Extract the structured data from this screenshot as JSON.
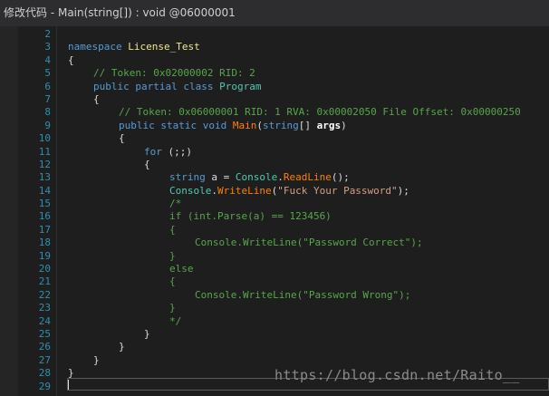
{
  "window": {
    "title": "修改代码 - Main(string[]) : void @06000001"
  },
  "editor": {
    "lines": [
      {
        "n": "2",
        "indent": 0,
        "tokens": []
      },
      {
        "n": "3",
        "indent": 0,
        "tokens": [
          {
            "t": "namespace",
            "k": "keyword"
          },
          {
            "t": " ",
            "k": "plain"
          },
          {
            "t": "License_Test",
            "k": "ns"
          }
        ]
      },
      {
        "n": "4",
        "indent": 0,
        "tokens": [
          {
            "t": "{",
            "k": "plain"
          }
        ]
      },
      {
        "n": "5",
        "indent": 1,
        "tokens": [
          {
            "t": "// Token: 0x02000002 RID: 2",
            "k": "comment"
          }
        ]
      },
      {
        "n": "6",
        "indent": 1,
        "tokens": [
          {
            "t": "public",
            "k": "keyword"
          },
          {
            "t": " ",
            "k": "plain"
          },
          {
            "t": "partial",
            "k": "keyword"
          },
          {
            "t": " ",
            "k": "plain"
          },
          {
            "t": "class",
            "k": "keyword"
          },
          {
            "t": " ",
            "k": "plain"
          },
          {
            "t": "Program",
            "k": "type"
          }
        ]
      },
      {
        "n": "7",
        "indent": 1,
        "tokens": [
          {
            "t": "{",
            "k": "plain"
          }
        ]
      },
      {
        "n": "8",
        "indent": 2,
        "tokens": [
          {
            "t": "// Token: 0x06000001 RID: 1 RVA: 0x00002050 File Offset: 0x00000250",
            "k": "comment"
          }
        ]
      },
      {
        "n": "9",
        "indent": 2,
        "tokens": [
          {
            "t": "public",
            "k": "keyword"
          },
          {
            "t": " ",
            "k": "plain"
          },
          {
            "t": "static",
            "k": "keyword"
          },
          {
            "t": " ",
            "k": "plain"
          },
          {
            "t": "void",
            "k": "keyword"
          },
          {
            "t": " ",
            "k": "plain"
          },
          {
            "t": "Main",
            "k": "method"
          },
          {
            "t": "(",
            "k": "plain"
          },
          {
            "t": "string",
            "k": "keyword"
          },
          {
            "t": "[] ",
            "k": "plain"
          },
          {
            "t": "args",
            "k": "param"
          },
          {
            "t": ")",
            "k": "plain"
          }
        ]
      },
      {
        "n": "10",
        "indent": 2,
        "tokens": [
          {
            "t": "{",
            "k": "plain"
          }
        ]
      },
      {
        "n": "11",
        "indent": 3,
        "tokens": [
          {
            "t": "for",
            "k": "keyword"
          },
          {
            "t": " (;;)",
            "k": "plain"
          }
        ]
      },
      {
        "n": "12",
        "indent": 3,
        "tokens": [
          {
            "t": "{",
            "k": "plain"
          }
        ]
      },
      {
        "n": "13",
        "indent": 4,
        "tokens": [
          {
            "t": "string",
            "k": "keyword"
          },
          {
            "t": " a = ",
            "k": "plain"
          },
          {
            "t": "Console",
            "k": "type"
          },
          {
            "t": ".",
            "k": "plain"
          },
          {
            "t": "ReadLine",
            "k": "method"
          },
          {
            "t": "();",
            "k": "plain"
          }
        ]
      },
      {
        "n": "14",
        "indent": 4,
        "tokens": [
          {
            "t": "Console",
            "k": "type"
          },
          {
            "t": ".",
            "k": "plain"
          },
          {
            "t": "WriteLine",
            "k": "method"
          },
          {
            "t": "(",
            "k": "plain"
          },
          {
            "t": "\"Fuck Your Password\"",
            "k": "string"
          },
          {
            "t": ");",
            "k": "plain"
          }
        ]
      },
      {
        "n": "15",
        "indent": 4,
        "tokens": [
          {
            "t": "/*",
            "k": "comment"
          }
        ]
      },
      {
        "n": "16",
        "indent": 4,
        "tokens": [
          {
            "t": "if (int.Parse(a) == 123456)",
            "k": "comment"
          }
        ]
      },
      {
        "n": "17",
        "indent": 4,
        "tokens": [
          {
            "t": "{",
            "k": "comment"
          }
        ]
      },
      {
        "n": "18",
        "indent": 5,
        "tokens": [
          {
            "t": "Console.WriteLine(\"Password Correct\");",
            "k": "comment"
          }
        ]
      },
      {
        "n": "19",
        "indent": 4,
        "tokens": [
          {
            "t": "}",
            "k": "comment"
          }
        ]
      },
      {
        "n": "20",
        "indent": 4,
        "tokens": [
          {
            "t": "else",
            "k": "comment"
          }
        ]
      },
      {
        "n": "21",
        "indent": 4,
        "tokens": [
          {
            "t": "{",
            "k": "comment"
          }
        ]
      },
      {
        "n": "22",
        "indent": 5,
        "tokens": [
          {
            "t": "Console.WriteLine(\"Password Wrong\");",
            "k": "comment"
          }
        ]
      },
      {
        "n": "23",
        "indent": 4,
        "tokens": [
          {
            "t": "}",
            "k": "comment"
          }
        ]
      },
      {
        "n": "24",
        "indent": 4,
        "tokens": [
          {
            "t": "*/",
            "k": "comment"
          }
        ]
      },
      {
        "n": "25",
        "indent": 3,
        "tokens": [
          {
            "t": "}",
            "k": "plain"
          }
        ]
      },
      {
        "n": "26",
        "indent": 2,
        "tokens": [
          {
            "t": "}",
            "k": "plain"
          }
        ]
      },
      {
        "n": "27",
        "indent": 1,
        "tokens": [
          {
            "t": "}",
            "k": "plain"
          }
        ]
      },
      {
        "n": "28",
        "indent": 0,
        "tokens": [
          {
            "t": "}",
            "k": "plain"
          }
        ]
      },
      {
        "n": "29",
        "indent": 0,
        "tokens": []
      }
    ]
  },
  "watermark": "https://blog.csdn.net/Raito__",
  "colors": {
    "background": "#1e1e1e",
    "titlebar": "#2d2d30",
    "line_number": "#2b91af",
    "keyword": "#569cd6",
    "type": "#4ec9b0",
    "method": "#ff8000",
    "comment": "#57a64a",
    "string": "#d69d85",
    "namespace": "#f0e68c",
    "plain": "#dcdcdc"
  }
}
